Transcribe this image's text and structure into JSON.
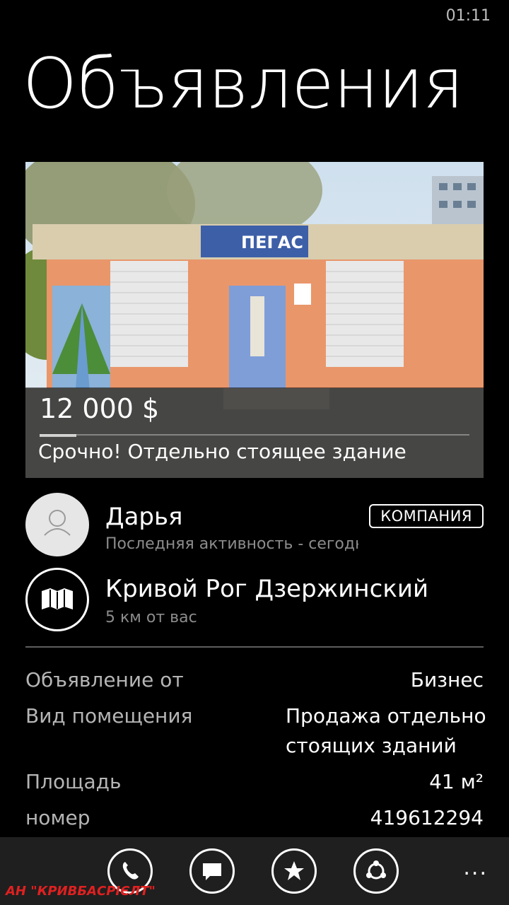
{
  "status_bar": {
    "time": "01:11"
  },
  "page": {
    "title": "Объявления"
  },
  "listing": {
    "price": "12 000 $",
    "title": "Срочно! Отдельно стоящее здание",
    "photo_signs": {
      "store_sign": "ПЕГАС"
    }
  },
  "seller": {
    "name": "Дарья",
    "activity": "Последняя активность - сегодня",
    "badge": "КОМПАНИЯ"
  },
  "location": {
    "name": "Кривой Рог Дзержинский",
    "distance": "5 км от вас"
  },
  "details": [
    {
      "label": "Объявление от",
      "value": "Бизнес"
    },
    {
      "label": "Вид помещения",
      "value": "Продажа отдельно стоящих зданий"
    },
    {
      "label": "Площадь",
      "value": "41 м²"
    },
    {
      "label": "номер",
      "value": "419612294"
    }
  ],
  "app_bar": {
    "buttons": [
      "phone-icon",
      "message-icon",
      "star-icon",
      "share-icon"
    ],
    "more": "..."
  },
  "watermark": "АН \"КРИВБАСРІЄЛТ\""
}
